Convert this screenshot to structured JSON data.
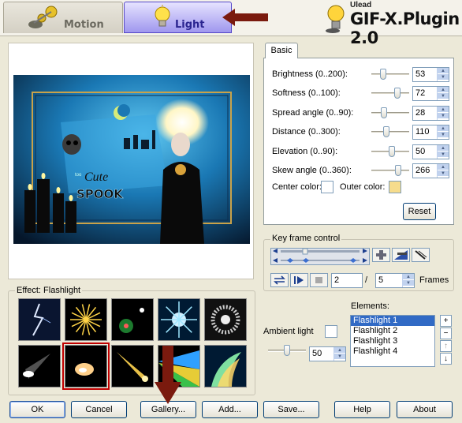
{
  "header": {
    "tabs": [
      {
        "label": "Motion"
      },
      {
        "label": "Light"
      }
    ],
    "brand_small": "Ulead",
    "brand_title": "GIF-X.Plugin 2.0"
  },
  "settings": {
    "tab_label": "Basic",
    "params": [
      {
        "label": "Brightness (0..200):",
        "value": "53",
        "level": 0.265
      },
      {
        "label": "Softness (0..100):",
        "value": "72",
        "level": 0.72
      },
      {
        "label": "Spread angle (0..90):",
        "value": "28",
        "level": 0.31
      },
      {
        "label": "Distance (0..300):",
        "value": "110",
        "level": 0.37
      },
      {
        "label": "Elevation (0..90):",
        "value": "50",
        "level": 0.56
      },
      {
        "label": "Skew angle (0..360):",
        "value": "266",
        "level": 0.74
      }
    ],
    "center_color_label": "Center color:",
    "center_color": "#ffffff",
    "outer_color_label": "Outer color:",
    "outer_color": "#f6dc8c",
    "reset_label": "Reset"
  },
  "keyframe": {
    "label": "Key frame control",
    "current_frame": "2",
    "separator": "/",
    "total_frames": "5",
    "frames_label": "Frames"
  },
  "effect": {
    "label": "Effect: Flashlight",
    "thumbnails": [
      {
        "name": "lightning-thumb"
      },
      {
        "name": "firework-thumb"
      },
      {
        "name": "lens-flare-thumb"
      },
      {
        "name": "starburst-thumb"
      },
      {
        "name": "ring-thumb"
      },
      {
        "name": "spotlight-thumb"
      },
      {
        "name": "flashlight-thumb",
        "selected": true
      },
      {
        "name": "comet-thumb"
      },
      {
        "name": "prism-thumb"
      },
      {
        "name": "aurora-thumb"
      }
    ]
  },
  "ambient": {
    "label": "Ambient light",
    "value": "50",
    "level": 0.5
  },
  "elements": {
    "label": "Elements:",
    "items": [
      "Flashlight 1",
      "Flashlight 2",
      "Flashlight 3",
      "Flashlight 4"
    ],
    "selected_index": 0,
    "add_symbol": "+",
    "remove_symbol": "−",
    "up_symbol": "↑",
    "down_symbol": "↓"
  },
  "buttons": {
    "ok": "OK",
    "cancel": "Cancel",
    "gallery": "Gallery...",
    "add": "Add...",
    "save": "Save...",
    "help": "Help",
    "about": "About"
  },
  "preview": {
    "caption_small": "too",
    "caption_cute": "Cute",
    "caption_spook": "SPOOK"
  },
  "colors": {
    "accent_red": "#c00000",
    "arrow": "#7a1a0e",
    "selection": "#316ac5"
  }
}
